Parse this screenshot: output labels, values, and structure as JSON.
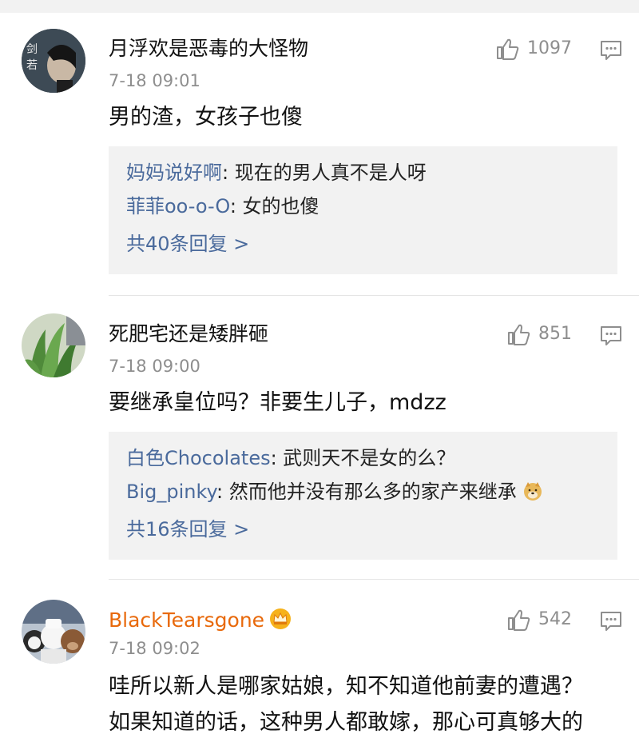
{
  "comments": [
    {
      "username": "月浮欢是恶毒的大怪物",
      "time": "7-18 09:01",
      "likes": "1097",
      "text": [
        "男的渣，女孩子也傻"
      ],
      "replies": [
        {
          "name": "妈妈说好啊",
          "text": ": 现在的男人真不是人呀"
        },
        {
          "name": "菲菲oo-o-O",
          "text": ": 女的也傻"
        }
      ],
      "more": "共40条回复 >"
    },
    {
      "username": "死肥宅还是矮胖砸",
      "time": "7-18 09:00",
      "likes": "851",
      "text": [
        "要继承皇位吗？非要生儿子，mdzz"
      ],
      "replies": [
        {
          "name": "白色Chocolates",
          "text": ": 武则天不是女的么？"
        },
        {
          "name": "Big_pinky",
          "text": ": 然而他并没有那么多的家产来继承"
        }
      ],
      "more": "共16条回复 >"
    },
    {
      "username": "BlackTearsgone",
      "time": "7-18 09:02",
      "likes": "542",
      "text": [
        "哇所以新人是哪家姑娘，知不知道他前妻的遭遇？",
        "如果知道的话，这种男人都敢嫁，那心可真够大的"
      ]
    }
  ],
  "icons": {
    "like": "thumbs-up-icon",
    "reply": "comment-bubble-icon",
    "vip": "crown-badge-icon",
    "emoji": "doge-emoji-icon"
  },
  "colors": {
    "username_vip": "#e8690b",
    "reply_name": "#4a6a9c",
    "muted": "#8e8e8e"
  }
}
